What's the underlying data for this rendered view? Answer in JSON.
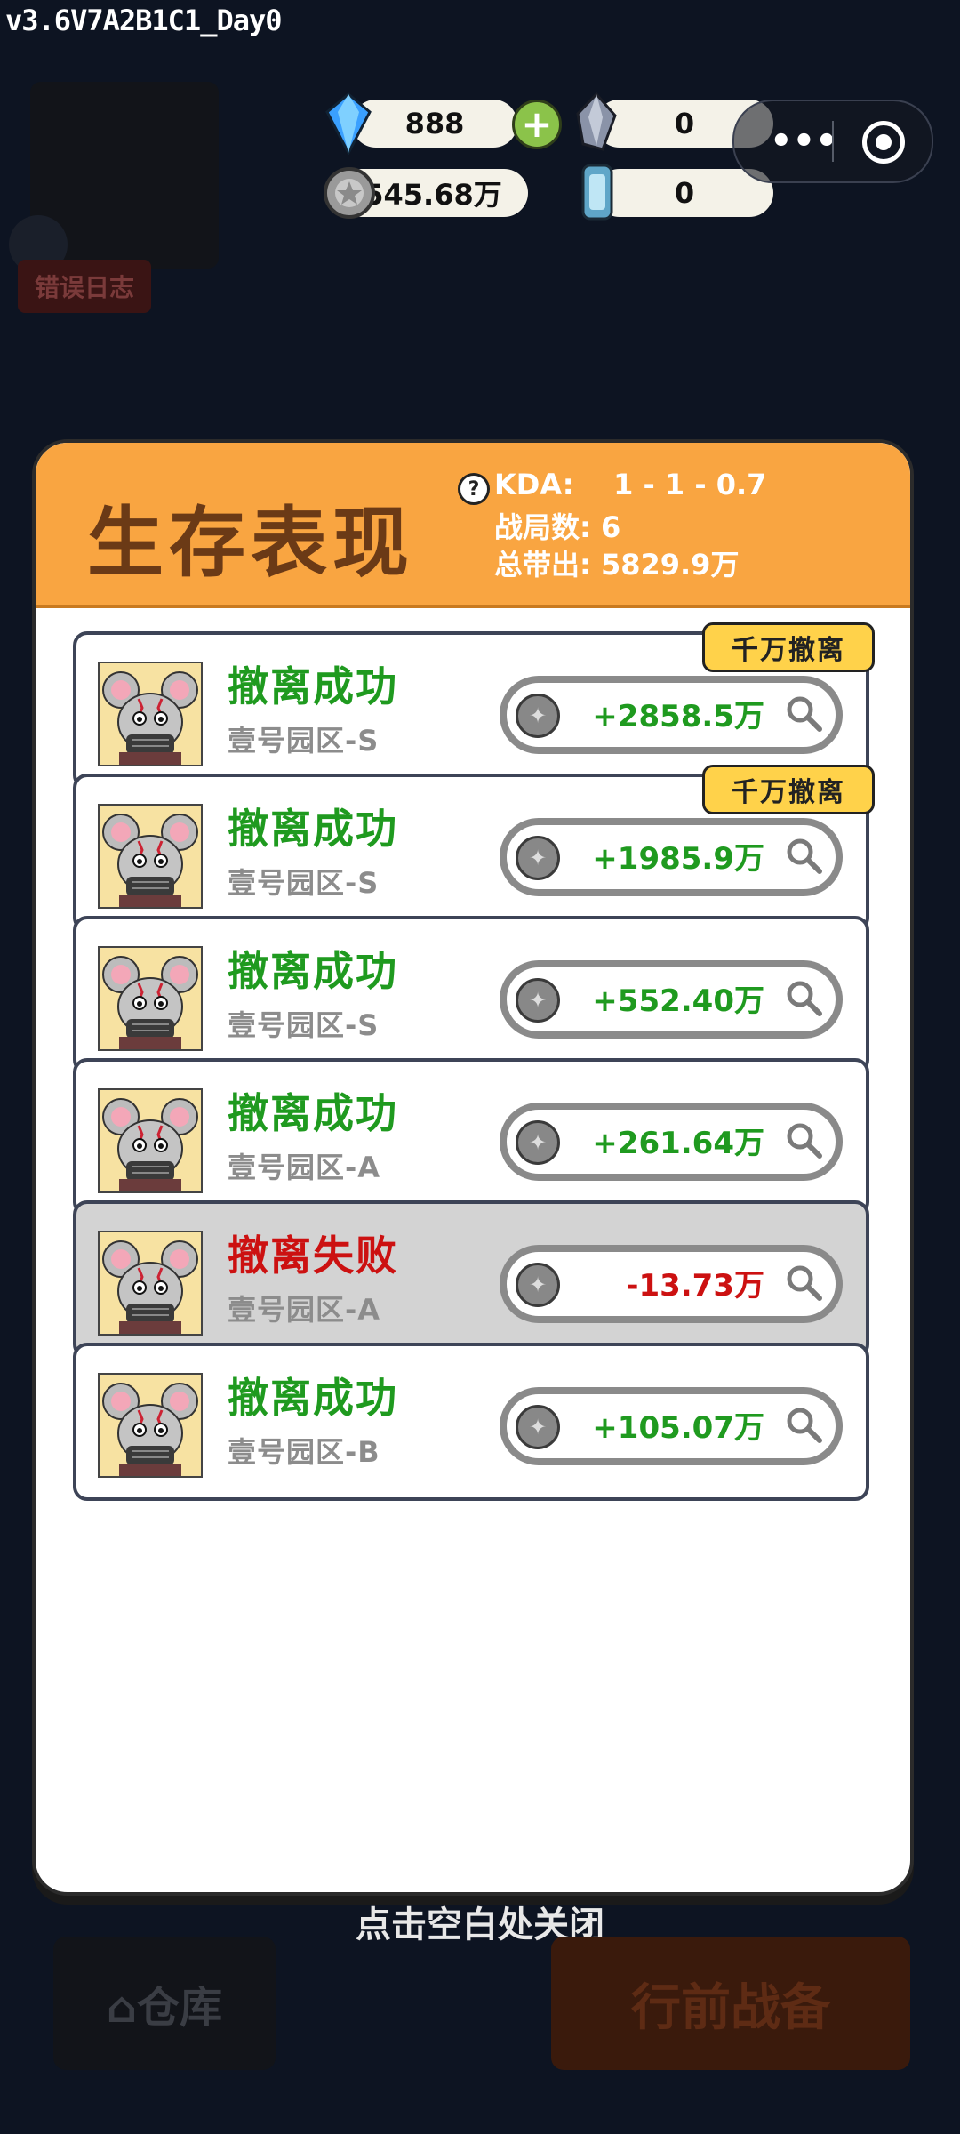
{
  "version_label": "v3.6V7A2B1C1_Day0",
  "topbar": {
    "gems": "888",
    "crystals": "0",
    "coins": "545.68万",
    "tokens": "0",
    "more_glyph": "•••"
  },
  "background": {
    "error_log": "错误日志",
    "close_hint": "点击空白处关闭",
    "warehouse_button": "⌂仓库",
    "prepare_button": "行前战备"
  },
  "modal": {
    "title": "生存表现",
    "help_glyph": "?",
    "kda_label": "KDA:",
    "kda_value": "1 - 1 - 0.7",
    "matches_label": "战局数:",
    "matches_value": "6",
    "total_label": "总带出:",
    "total_value": "5829.9万"
  },
  "records": [
    {
      "result": "撤离成功",
      "zone": "壹号园区-S",
      "amount": "+2858.5万",
      "badge": "千万撤离",
      "status": "success"
    },
    {
      "result": "撤离成功",
      "zone": "壹号园区-S",
      "amount": "+1985.9万",
      "badge": "千万撤离",
      "status": "success"
    },
    {
      "result": "撤离成功",
      "zone": "壹号园区-S",
      "amount": "+552.40万",
      "badge": "",
      "status": "success"
    },
    {
      "result": "撤离成功",
      "zone": "壹号园区-A",
      "amount": "+261.64万",
      "badge": "",
      "status": "success"
    },
    {
      "result": "撤离失败",
      "zone": "壹号园区-A",
      "amount": "-13.73万",
      "badge": "",
      "status": "failed"
    },
    {
      "result": "撤离成功",
      "zone": "壹号园区-B",
      "amount": "+105.07万",
      "badge": "",
      "status": "success"
    }
  ],
  "colors": {
    "success": "#1f9a1f",
    "failed": "#cc1111",
    "header": "#f9a541",
    "badge": "#ffd24a"
  }
}
